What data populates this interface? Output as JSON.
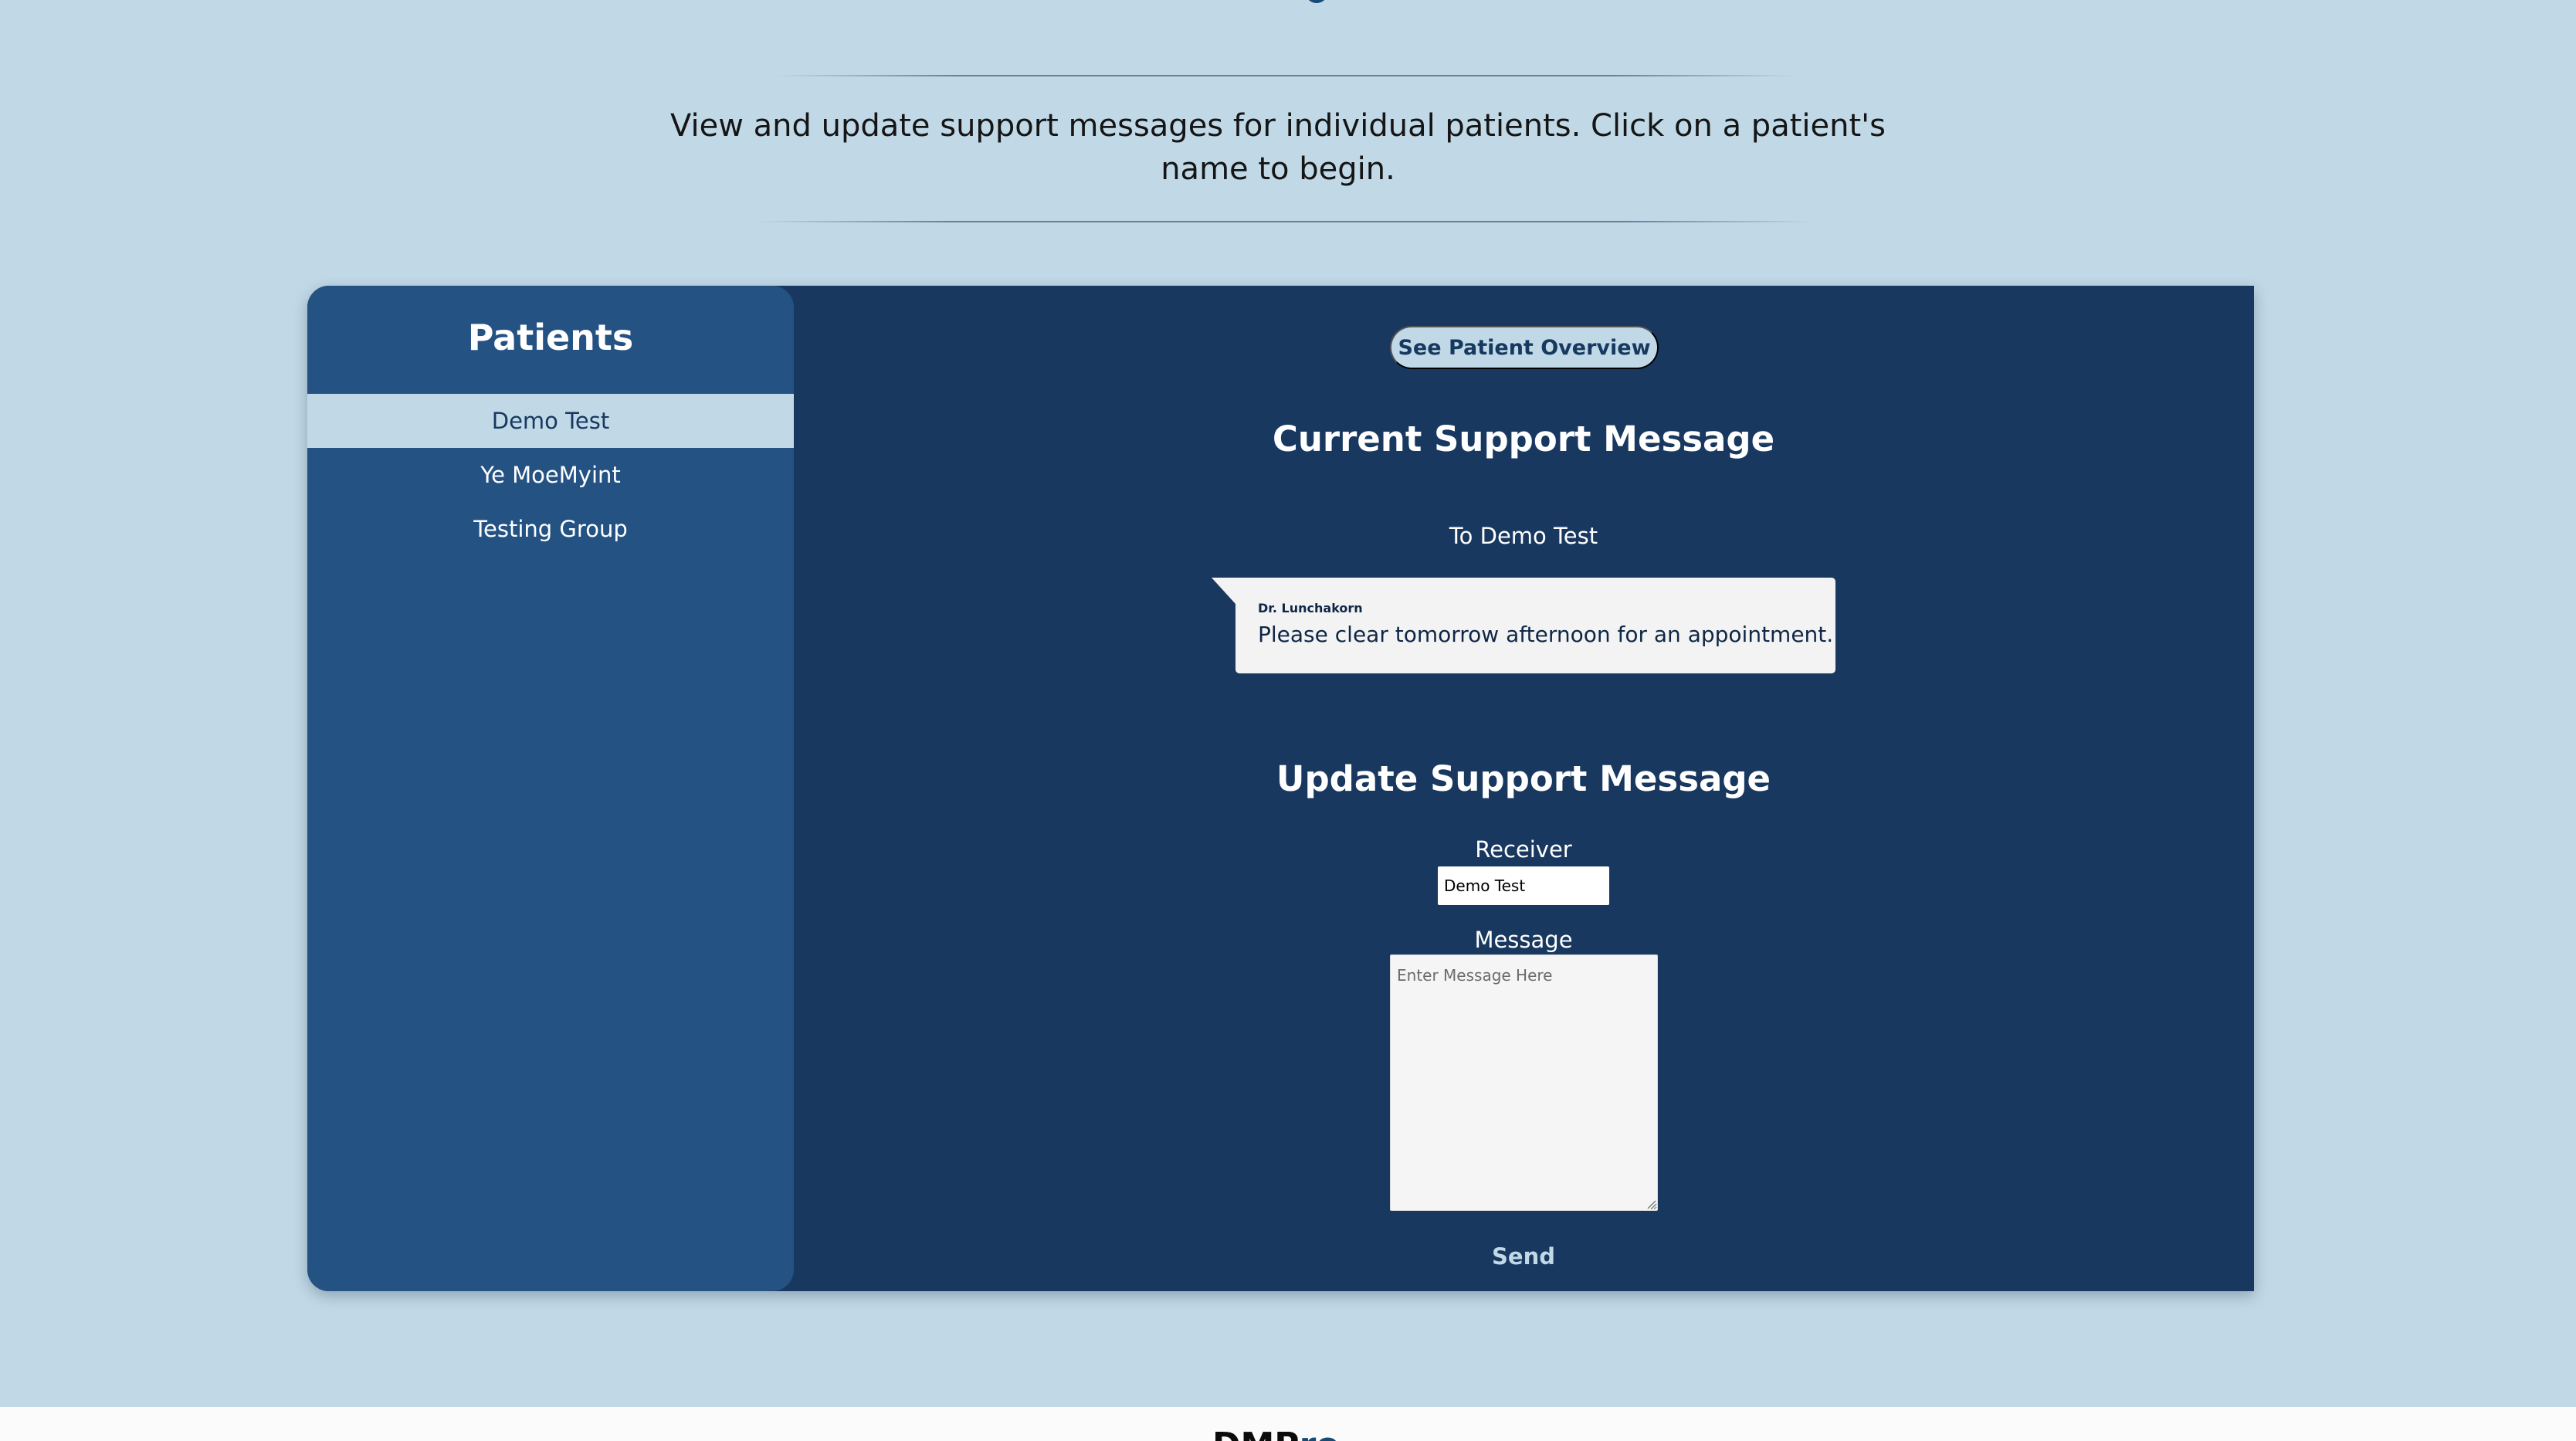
{
  "intro": {
    "text": "View and update support messages for individual patients. Click on a patient's name to begin."
  },
  "colors": {
    "page_background": "#c1d9e7",
    "main_panel": "#183860",
    "sidebar": "#245283",
    "selected_item": "#c1d9e7",
    "text_primary": "#ffffff",
    "accent_dark": "#173860"
  },
  "sidebar": {
    "title": "Patients",
    "items": [
      {
        "label": "Demo Test",
        "selected": true
      },
      {
        "label": "Ye MoeMyint",
        "selected": false
      },
      {
        "label": "Testing Group",
        "selected": false
      }
    ]
  },
  "main": {
    "overview_button": "See Patient Overview",
    "current_message": {
      "title": "Current Support Message",
      "recipient_line": "To Demo Test",
      "sender": "Dr. Lunchakorn",
      "message": "Please clear tomorrow afternoon for an appointment."
    },
    "update_message": {
      "title": "Update Support Message",
      "receiver_label": "Receiver",
      "receiver_value": "Demo Test",
      "message_label": "Message",
      "message_placeholder": "Enter Message Here",
      "send_label": "Send"
    }
  },
  "footer": {
    "logo_text_dark": "DMP",
    "logo_text_accent": "ro"
  },
  "icons": {
    "top_logo": "partial-logo-icon",
    "textarea_resize": "resize-grip-icon"
  }
}
